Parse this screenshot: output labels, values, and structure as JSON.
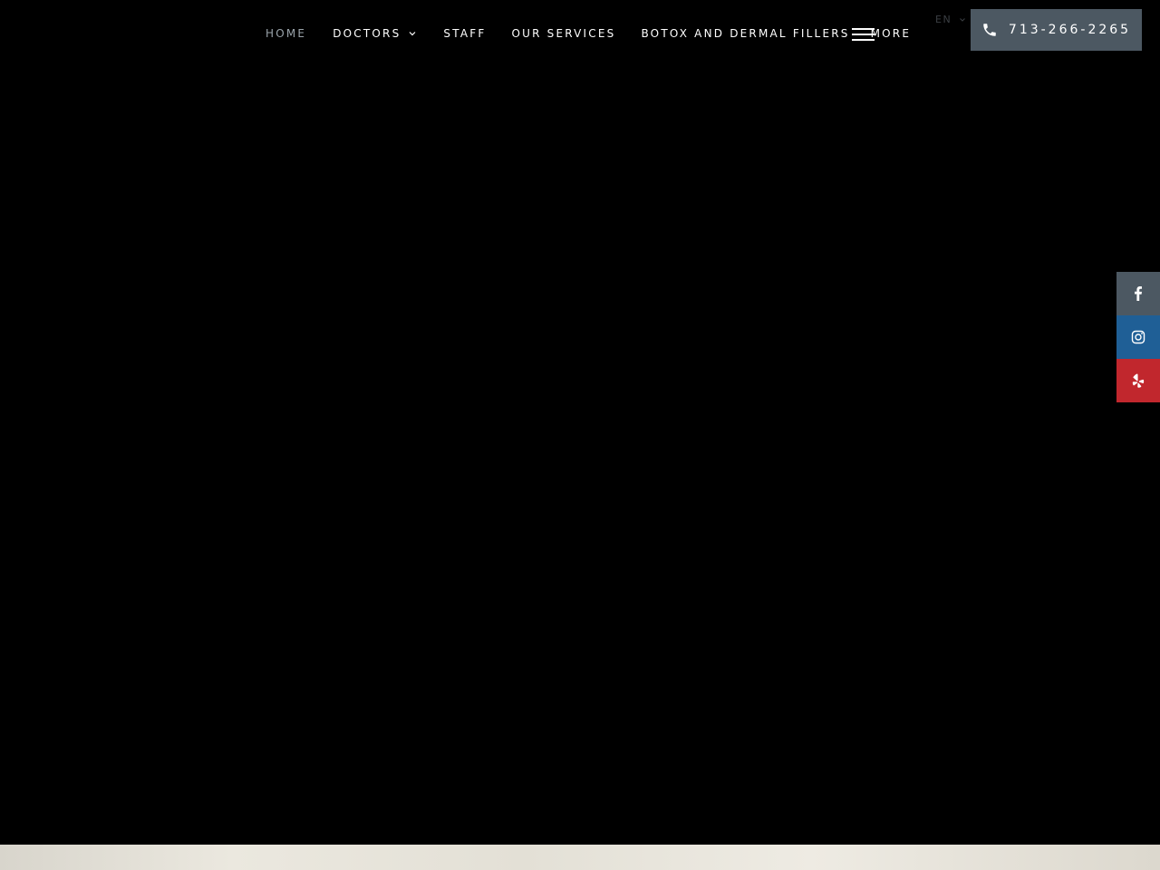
{
  "nav": {
    "items": [
      {
        "label": "HOME",
        "active": true
      },
      {
        "label": "DOCTORS",
        "has_dropdown": true
      },
      {
        "label": "STAFF"
      },
      {
        "label": "OUR SERVICES"
      },
      {
        "label": "BOTOX AND DERMAL FILLERS"
      },
      {
        "label": "MORE"
      }
    ]
  },
  "language": {
    "label": "EN"
  },
  "phone": {
    "label": "713-266-2265",
    "icon": "phone-icon"
  },
  "social": [
    {
      "name": "facebook",
      "icon": "facebook-icon",
      "color": "#4c5862"
    },
    {
      "name": "instagram",
      "icon": "instagram-icon",
      "color": "#1f5f96"
    },
    {
      "name": "yelp",
      "icon": "yelp-icon",
      "color": "#c1272d"
    }
  ],
  "colors": {
    "background": "#000000",
    "phone_bg": "#4c5862",
    "nav_active": "#9aa3aa"
  }
}
